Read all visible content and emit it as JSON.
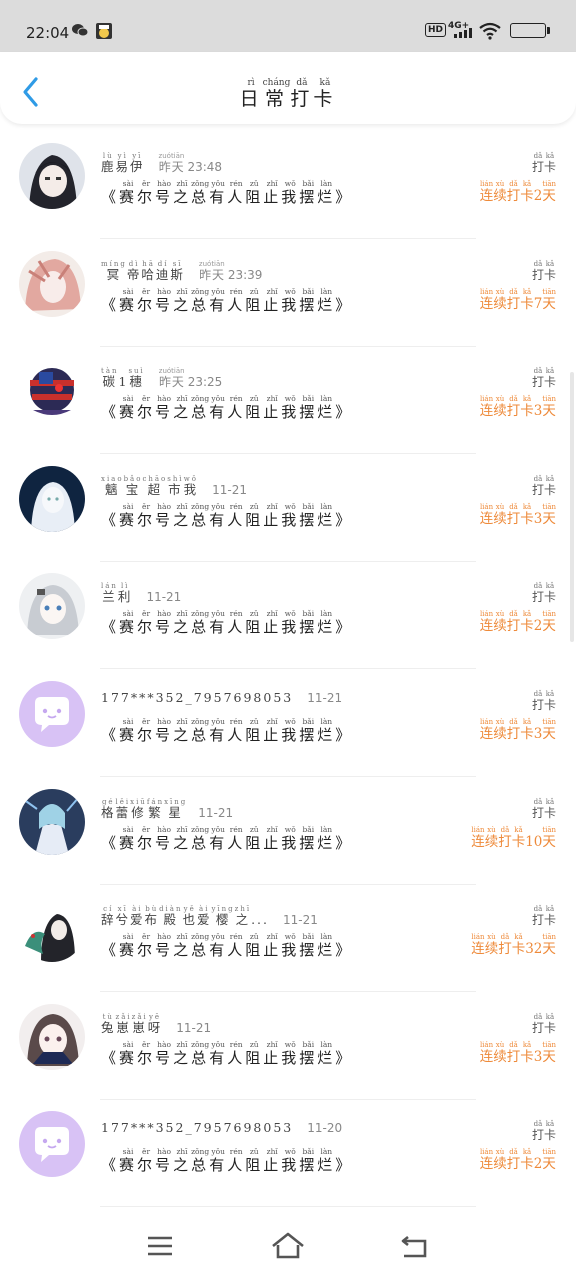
{
  "status": {
    "time": "22:04",
    "network": "4G+",
    "hd": "HD",
    "icons": [
      "wechat-icon",
      "app-icon",
      "hd-icon",
      "signal-icon",
      "wifi-icon",
      "battery-icon"
    ]
  },
  "header": {
    "back_icon": "chevron-left-icon",
    "title_chars": [
      {
        "char": "日",
        "pinyin": "rì"
      },
      {
        "char": "常",
        "pinyin": "cháng"
      },
      {
        "char": "打",
        "pinyin": "dǎ"
      },
      {
        "char": "卡",
        "pinyin": "kǎ"
      }
    ]
  },
  "colors": {
    "accent": "#ee8a3a",
    "back": "#2f9be6",
    "default_avatar": "#d8c2f5"
  },
  "post_title_chars": [
    {
      "char": "《",
      "pinyin": ""
    },
    {
      "char": "赛",
      "pinyin": "sài"
    },
    {
      "char": "尔",
      "pinyin": "ěr"
    },
    {
      "char": "号",
      "pinyin": "hào"
    },
    {
      "char": "之",
      "pinyin": "zhī"
    },
    {
      "char": "总",
      "pinyin": "zǒng"
    },
    {
      "char": "有",
      "pinyin": "yǒu"
    },
    {
      "char": "人",
      "pinyin": "rén"
    },
    {
      "char": "阻",
      "pinyin": "zǔ"
    },
    {
      "char": "止",
      "pinyin": "zhǐ"
    },
    {
      "char": "我",
      "pinyin": "wǒ"
    },
    {
      "char": "摆",
      "pinyin": "bǎi"
    },
    {
      "char": "烂",
      "pinyin": "làn"
    },
    {
      "char": "》",
      "pinyin": ""
    }
  ],
  "checkin_label": [
    {
      "char": "打",
      "pinyin": "dǎ"
    },
    {
      "char": "卡",
      "pinyin": "kǎ"
    }
  ],
  "streak_prefix": [
    {
      "char": "连",
      "pinyin": "lián"
    },
    {
      "char": "续",
      "pinyin": "xù"
    },
    {
      "char": "打",
      "pinyin": "dǎ"
    },
    {
      "char": "卡",
      "pinyin": "kǎ"
    }
  ],
  "streak_suffix": {
    "char": "天",
    "pinyin": "tiān"
  },
  "entries": [
    {
      "name": [
        {
          "char": "鹿",
          "pinyin": "lù"
        },
        {
          "char": "易",
          "pinyin": "yì"
        },
        {
          "char": "伊",
          "pinyin": "yī"
        }
      ],
      "time_prefix": [
        {
          "char": "昨",
          "pinyin": "zuó"
        },
        {
          "char": "天",
          "pinyin": "tiān"
        }
      ],
      "time": "23:48",
      "streak_days": "2",
      "avatar": "avatar-dark-hair"
    },
    {
      "name": [
        {
          "char": "冥",
          "pinyin": "míng"
        },
        {
          "char": "帝",
          "pinyin": "dì"
        },
        {
          "char": "哈",
          "pinyin": "hā"
        },
        {
          "char": "迪",
          "pinyin": "dí"
        },
        {
          "char": "斯",
          "pinyin": "sī"
        }
      ],
      "time_prefix": [
        {
          "char": "昨",
          "pinyin": "zuó"
        },
        {
          "char": "天",
          "pinyin": "tiān"
        }
      ],
      "time": "23:39",
      "streak_days": "7",
      "avatar": "avatar-pink-hair"
    },
    {
      "name": [
        {
          "char": "碳",
          "pinyin": "tàn"
        },
        {
          "char": "1",
          "pinyin": ""
        },
        {
          "char": "穗",
          "pinyin": "suì"
        }
      ],
      "time_prefix": [
        {
          "char": "昨",
          "pinyin": "zuó"
        },
        {
          "char": "天",
          "pinyin": "tiān"
        }
      ],
      "time": "23:25",
      "streak_days": "3",
      "avatar": "avatar-flag"
    },
    {
      "name": [
        {
          "char": "魑",
          "pinyin": "xiao"
        },
        {
          "char": "宝",
          "pinyin": "bǎo"
        },
        {
          "char": "超",
          "pinyin": "chāo"
        },
        {
          "char": "市",
          "pinyin": "shì"
        },
        {
          "char": "我",
          "pinyin": "wǒ"
        }
      ],
      "time_prefix": [],
      "time": "11-21",
      "streak_days": "3",
      "avatar": "avatar-white-hair"
    },
    {
      "name": [
        {
          "char": "兰",
          "pinyin": "lán"
        },
        {
          "char": "利",
          "pinyin": "lì"
        }
      ],
      "time_prefix": [],
      "time": "11-21",
      "streak_days": "2",
      "avatar": "avatar-silver-hair"
    },
    {
      "name": [
        {
          "char": "177***352_7957698053",
          "pinyin": ""
        }
      ],
      "time_prefix": [],
      "time": "11-21",
      "streak_days": "3",
      "avatar": "default-chat-avatar"
    },
    {
      "name": [
        {
          "char": "格",
          "pinyin": "gé"
        },
        {
          "char": "蕾",
          "pinyin": "lěi"
        },
        {
          "char": "修",
          "pinyin": "xiū"
        },
        {
          "char": "繁",
          "pinyin": "fán"
        },
        {
          "char": "星",
          "pinyin": "xīng"
        }
      ],
      "time_prefix": [],
      "time": "11-21",
      "streak_days": "10",
      "avatar": "avatar-blue-dress"
    },
    {
      "name": [
        {
          "char": "辞",
          "pinyin": "cí"
        },
        {
          "char": "兮",
          "pinyin": "xī"
        },
        {
          "char": "爱",
          "pinyin": "ài"
        },
        {
          "char": "布",
          "pinyin": "bù"
        },
        {
          "char": "殿",
          "pinyin": "diàn"
        },
        {
          "char": "也",
          "pinyin": "yě"
        },
        {
          "char": "爱",
          "pinyin": "ài"
        },
        {
          "char": "樱",
          "pinyin": "yīng"
        },
        {
          "char": "之",
          "pinyin": "zhī"
        },
        {
          "char": "...",
          "pinyin": ""
        }
      ],
      "time_prefix": [],
      "time": "11-21",
      "streak_days": "32",
      "avatar": "avatar-dragon"
    },
    {
      "name": [
        {
          "char": "兔",
          "pinyin": "tù"
        },
        {
          "char": "崽",
          "pinyin": "zǎi"
        },
        {
          "char": "崽",
          "pinyin": "zǎi"
        },
        {
          "char": "呀",
          "pinyin": "yē"
        }
      ],
      "time_prefix": [],
      "time": "11-21",
      "streak_days": "3",
      "avatar": "avatar-brown-hair"
    },
    {
      "name": [
        {
          "char": "177***352_7957698053",
          "pinyin": ""
        }
      ],
      "time_prefix": [],
      "time": "11-20",
      "streak_days": "2",
      "avatar": "default-chat-avatar"
    }
  ],
  "nav": {
    "icons": [
      "menu-icon",
      "home-icon",
      "back-icon"
    ]
  }
}
